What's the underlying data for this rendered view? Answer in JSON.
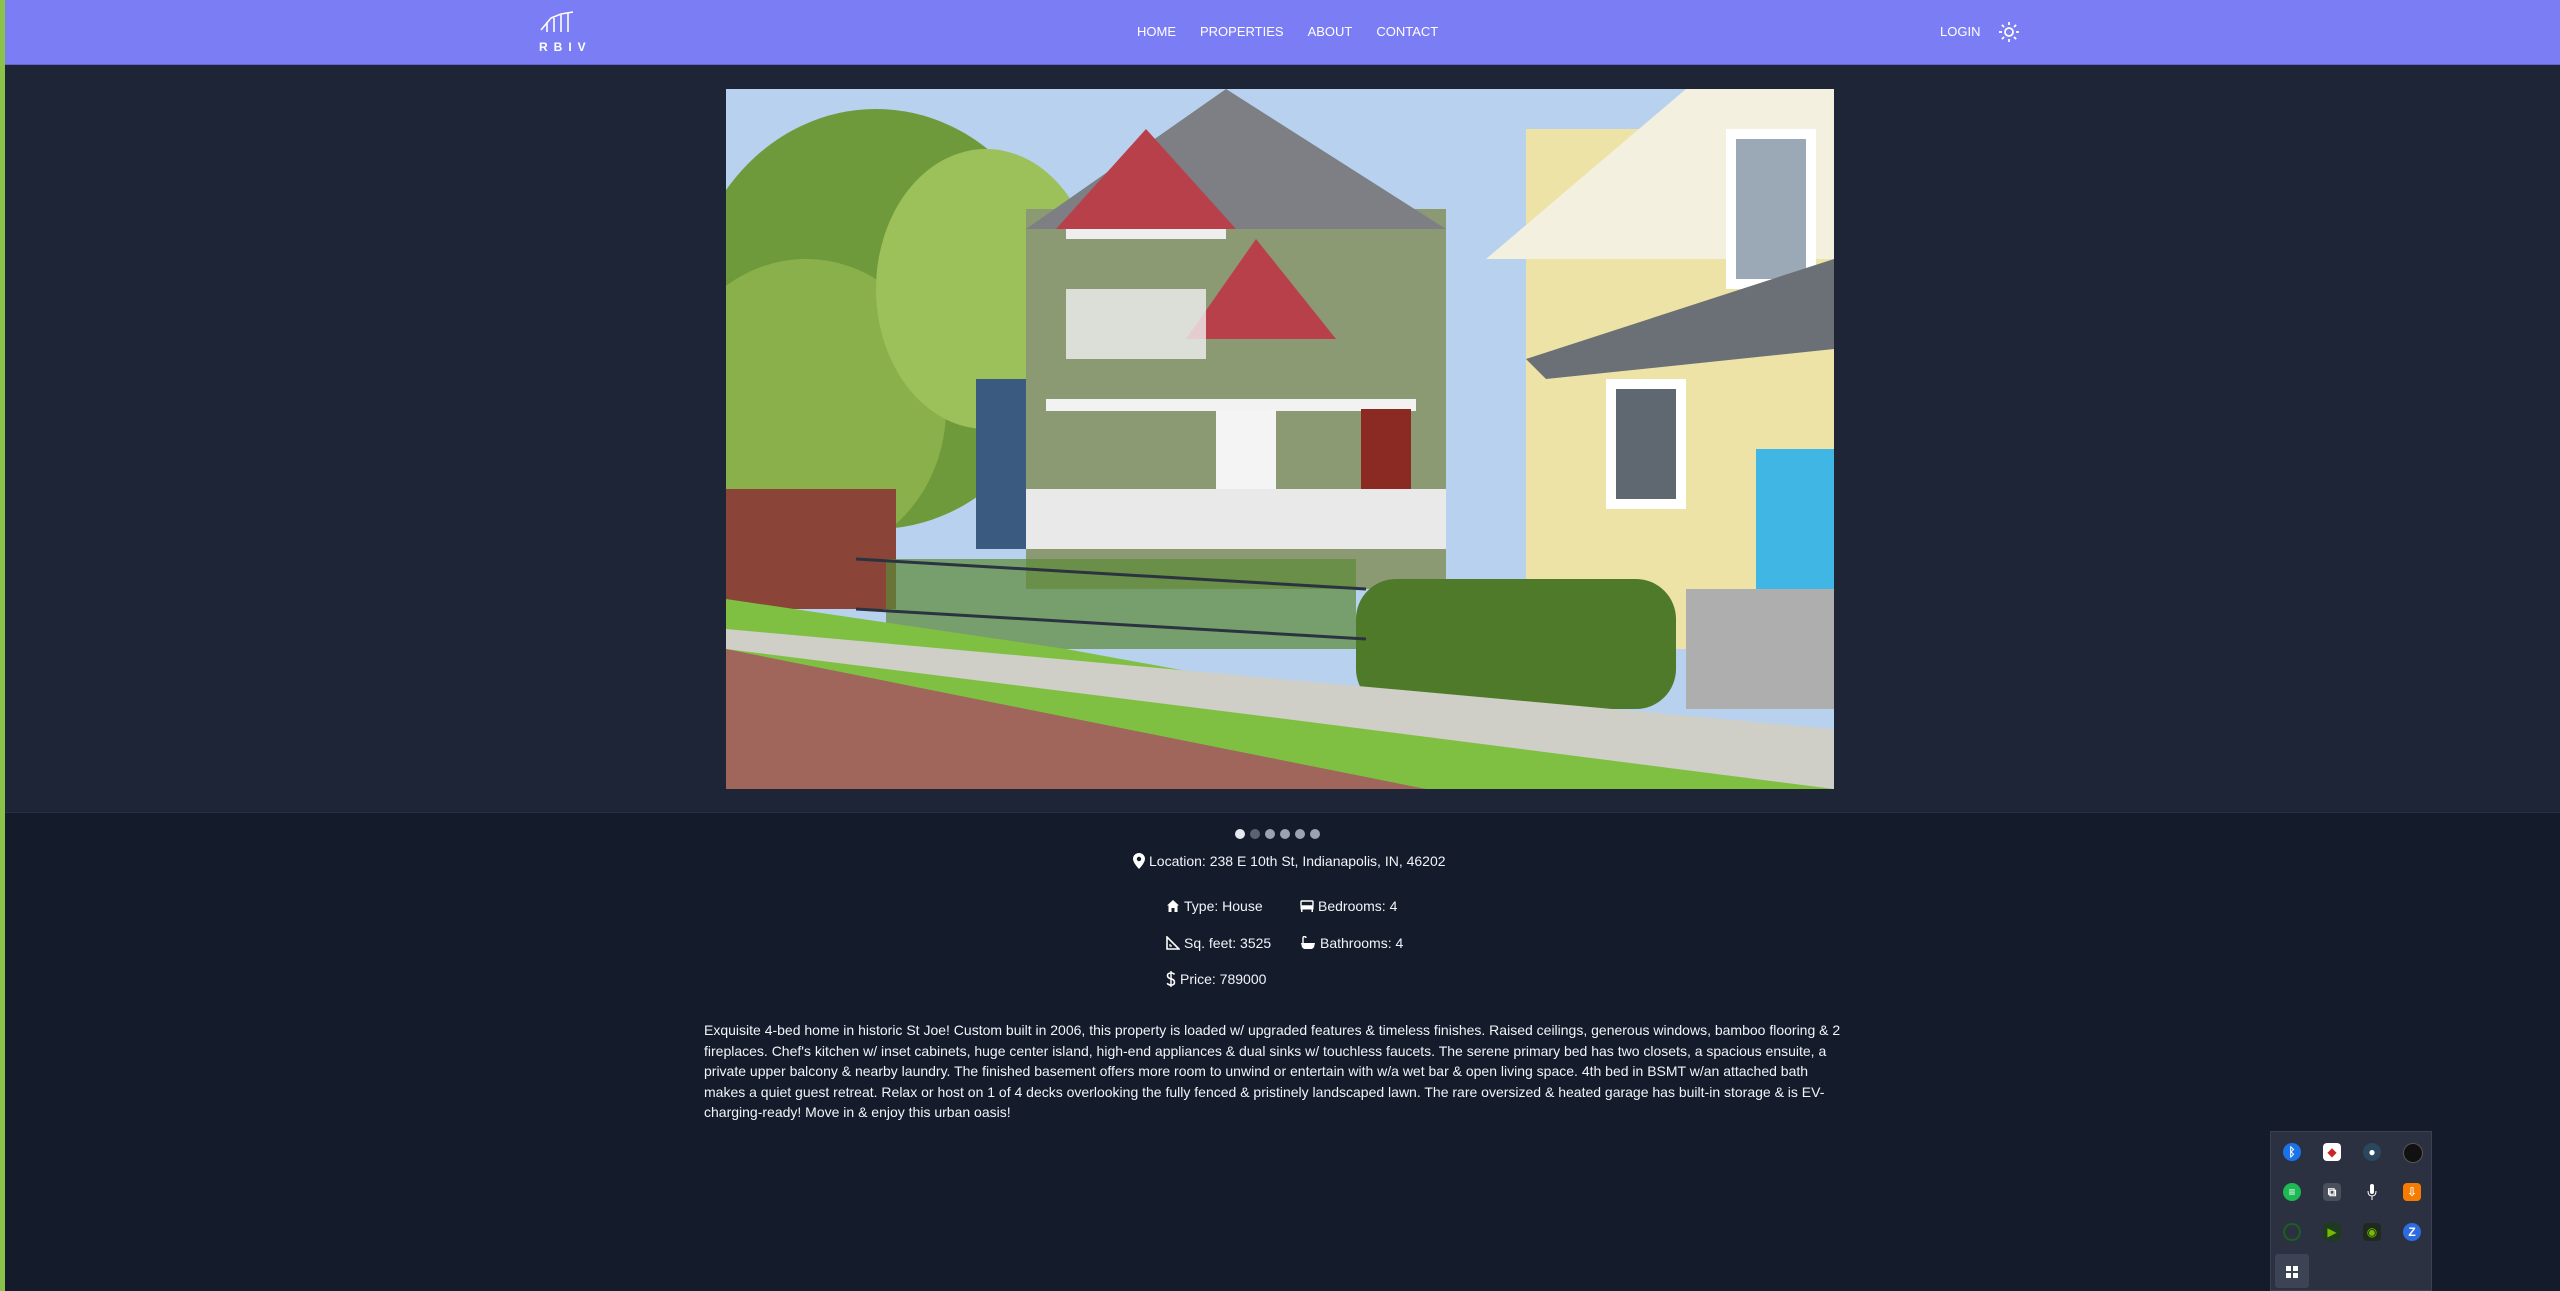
{
  "nav": {
    "logo_text": "RBIV",
    "links": [
      "HOME",
      "PROPERTIES",
      "ABOUT",
      "CONTACT"
    ],
    "login": "LOGIN",
    "theme_icon": "sun-icon"
  },
  "carousel": {
    "slide_count": 6,
    "active_index": 0,
    "image_alt": "photo of the property"
  },
  "property": {
    "location": "Location: 238 E 10th St, Indianapolis, IN, 46202",
    "type": "Type: House",
    "bedrooms": "Bedrooms: 4",
    "sqft": "Sq. feet: 3525",
    "bathrooms": "Bathrooms: 4",
    "price": "Price: 789000",
    "description": "Exquisite 4-bed home in historic St Joe! Custom built in 2006, this property is loaded w/ upgraded features & timeless finishes. Raised ceilings, generous windows, bamboo flooring & 2 fireplaces. Chef's kitchen w/ inset cabinets, huge center island, high-end appliances & dual sinks w/ touchless faucets. The serene primary bed has two closets, a spacious ensuite, a private upper balcony & nearby laundry. The finished basement offers more room to unwind or entertain with w/a wet bar & open living space. 4th bed in BSMT w/an attached bath makes a quiet guest retreat. Relax or host on 1 of 4 decks overlooking the fully fenced & pristinely landscaped lawn. The rare oversized & heated garage has built-in storage & is EV-charging-ready! Move in & enjoy this urban oasis!"
  },
  "tray": {
    "icons": [
      "bluetooth-icon",
      "security-shield-icon",
      "steam-icon",
      "obs-icon",
      "spotify-icon",
      "copy-icon",
      "microphone-icon",
      "update-icon",
      "network-icon",
      "media-play-icon",
      "nvidia-icon",
      "zoom-icon",
      "taskbar-pin-icon"
    ],
    "zoom_letter": "Z"
  },
  "colors": {
    "navbar": "#7b7df5",
    "page_bg": "#141b2b",
    "hero_bg": "#1e2536",
    "text": "#f1f5f9"
  }
}
